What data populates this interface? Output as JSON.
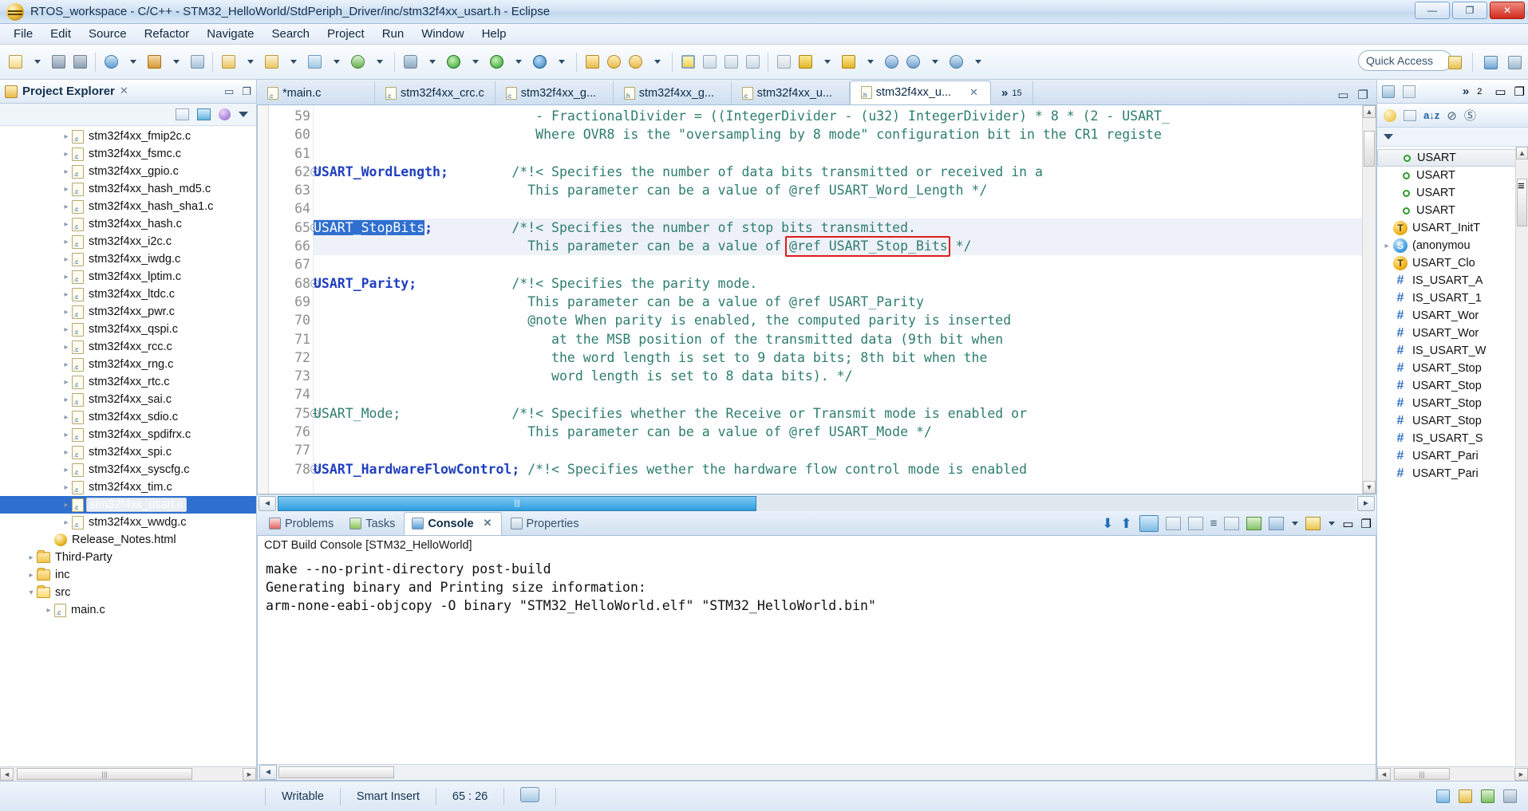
{
  "window": {
    "title": "RTOS_workspace - C/C++ - STM32_HelloWorld/StdPeriph_Driver/inc/stm32f4xx_usart.h - Eclipse",
    "minimize": "—",
    "maximize": "❐",
    "close": "✕"
  },
  "menu": [
    "File",
    "Edit",
    "Source",
    "Refactor",
    "Navigate",
    "Search",
    "Project",
    "Run",
    "Window",
    "Help"
  ],
  "toolbar": {
    "quick_access_placeholder": "Quick Access"
  },
  "project_explorer": {
    "title": "Project Explorer",
    "close_label": "✕",
    "items": [
      {
        "label": "stm32f4xx_fmip2c.c",
        "icon": "c-file-icon",
        "indent": 3,
        "arrow": true
      },
      {
        "label": "stm32f4xx_fsmc.c",
        "icon": "c-file-icon",
        "indent": 3,
        "arrow": true
      },
      {
        "label": "stm32f4xx_gpio.c",
        "icon": "c-file-icon",
        "indent": 3,
        "arrow": true
      },
      {
        "label": "stm32f4xx_hash_md5.c",
        "icon": "c-file-icon",
        "indent": 3,
        "arrow": true
      },
      {
        "label": "stm32f4xx_hash_sha1.c",
        "icon": "c-file-icon",
        "indent": 3,
        "arrow": true
      },
      {
        "label": "stm32f4xx_hash.c",
        "icon": "c-file-icon",
        "indent": 3,
        "arrow": true
      },
      {
        "label": "stm32f4xx_i2c.c",
        "icon": "c-file-icon",
        "indent": 3,
        "arrow": true
      },
      {
        "label": "stm32f4xx_iwdg.c",
        "icon": "c-file-icon",
        "indent": 3,
        "arrow": true
      },
      {
        "label": "stm32f4xx_lptim.c",
        "icon": "c-file-icon",
        "indent": 3,
        "arrow": true
      },
      {
        "label": "stm32f4xx_ltdc.c",
        "icon": "c-file-icon",
        "indent": 3,
        "arrow": true
      },
      {
        "label": "stm32f4xx_pwr.c",
        "icon": "c-file-icon",
        "indent": 3,
        "arrow": true
      },
      {
        "label": "stm32f4xx_qspi.c",
        "icon": "c-file-icon",
        "indent": 3,
        "arrow": true
      },
      {
        "label": "stm32f4xx_rcc.c",
        "icon": "c-file-icon",
        "indent": 3,
        "arrow": true
      },
      {
        "label": "stm32f4xx_rng.c",
        "icon": "c-file-icon",
        "indent": 3,
        "arrow": true
      },
      {
        "label": "stm32f4xx_rtc.c",
        "icon": "c-file-icon",
        "indent": 3,
        "arrow": true
      },
      {
        "label": "stm32f4xx_sai.c",
        "icon": "c-file-icon",
        "indent": 3,
        "arrow": true
      },
      {
        "label": "stm32f4xx_sdio.c",
        "icon": "c-file-icon",
        "indent": 3,
        "arrow": true
      },
      {
        "label": "stm32f4xx_spdifrx.c",
        "icon": "c-file-icon",
        "indent": 3,
        "arrow": true
      },
      {
        "label": "stm32f4xx_spi.c",
        "icon": "c-file-icon",
        "indent": 3,
        "arrow": true
      },
      {
        "label": "stm32f4xx_syscfg.c",
        "icon": "c-file-icon",
        "indent": 3,
        "arrow": true
      },
      {
        "label": "stm32f4xx_tim.c",
        "icon": "c-file-icon",
        "indent": 3,
        "arrow": true
      },
      {
        "label": "stm32f4xx_usart.c",
        "icon": "c-file-icon",
        "indent": 3,
        "arrow": true,
        "selected": true
      },
      {
        "label": "stm32f4xx_wwdg.c",
        "icon": "c-file-icon",
        "indent": 3,
        "arrow": true
      },
      {
        "label": "Release_Notes.html",
        "icon": "html-file-icon",
        "indent": 2,
        "arrow": false
      },
      {
        "label": "Third-Party",
        "icon": "folder-icon",
        "indent": 1,
        "arrow": true
      },
      {
        "label": "inc",
        "icon": "folder-icon",
        "indent": 1,
        "arrow": true
      },
      {
        "label": "src",
        "icon": "folder-open-icon",
        "indent": 1,
        "arrow": true,
        "expanded": true
      },
      {
        "label": "main.c",
        "icon": "c-file-icon",
        "indent": 2,
        "arrow": true
      }
    ]
  },
  "editor": {
    "tabs": [
      {
        "label": "*main.c",
        "type": "c",
        "active": false
      },
      {
        "label": "stm32f4xx_crc.c",
        "type": "c",
        "active": false
      },
      {
        "label": "stm32f4xx_g...",
        "type": "c",
        "active": false
      },
      {
        "label": "stm32f4xx_g...",
        "type": "h",
        "active": false
      },
      {
        "label": "stm32f4xx_u...",
        "type": "c",
        "active": false
      },
      {
        "label": "stm32f4xx_u...",
        "type": "h",
        "active": true
      }
    ],
    "overflow_label": "»",
    "overflow_count": "15",
    "close_label": "✕",
    "lines": [
      {
        "num": "59",
        "fold": false,
        "code": "                            - FractionalDivider = ((IntegerDivider - (u32) IntegerDivider) * 8 * (2 - USART_"
      },
      {
        "num": "60",
        "fold": false,
        "code": "                            Where OVR8 is the \"oversampling by 8 mode\" configuration bit in the CR1 registe"
      },
      {
        "num": "61",
        "fold": false,
        "code": ""
      },
      {
        "num": "62",
        "fold": true,
        "code": "USART_WordLength;        /*!< Specifies the number of data bits transmitted or received in a"
      },
      {
        "num": "63",
        "fold": false,
        "code": "                           This parameter can be a value of @ref USART_Word_Length */"
      },
      {
        "num": "64",
        "fold": false,
        "code": ""
      },
      {
        "num": "65",
        "fold": true,
        "code": "USART_StopBits;          /*!< Specifies the number of stop bits transmitted.",
        "highlight": true,
        "selected_token": "USART_StopBits"
      },
      {
        "num": "66",
        "fold": false,
        "code": "                           This parameter can be a value of @ref USART_Stop_Bits */",
        "highlight": true,
        "boxed_token": "@ref USART_Stop_Bits"
      },
      {
        "num": "67",
        "fold": false,
        "code": ""
      },
      {
        "num": "68",
        "fold": true,
        "code": "USART_Parity;            /*!< Specifies the parity mode."
      },
      {
        "num": "69",
        "fold": false,
        "code": "                           This parameter can be a value of @ref USART_Parity"
      },
      {
        "num": "70",
        "fold": false,
        "code": "                           @note When parity is enabled, the computed parity is inserted"
      },
      {
        "num": "71",
        "fold": false,
        "code": "                              at the MSB position of the transmitted data (9th bit when"
      },
      {
        "num": "72",
        "fold": false,
        "code": "                              the word length is set to 9 data bits; 8th bit when the"
      },
      {
        "num": "73",
        "fold": false,
        "code": "                              word length is set to 8 data bits). */"
      },
      {
        "num": "74",
        "fold": false,
        "code": ""
      },
      {
        "num": "75",
        "fold": true,
        "code": "USART_Mode;              /*!< Specifies whether the Receive or Transmit mode is enabled or"
      },
      {
        "num": "76",
        "fold": false,
        "code": "                           This parameter can be a value of @ref USART_Mode */"
      },
      {
        "num": "77",
        "fold": false,
        "code": ""
      },
      {
        "num": "78",
        "fold": true,
        "code": "USART_HardwareFlowControl; /*!< Specifies wether the hardware flow control mode is enabled"
      }
    ],
    "annotation_color": "#e01b1b"
  },
  "console": {
    "tabs": [
      {
        "label": "Problems",
        "icon": "problems-icon",
        "active": false
      },
      {
        "label": "Tasks",
        "icon": "tasks-icon",
        "active": false
      },
      {
        "label": "Console",
        "icon": "console-icon",
        "active": true
      },
      {
        "label": "Properties",
        "icon": "properties-icon",
        "active": false
      }
    ],
    "close_label": "✕",
    "header": "CDT Build Console [STM32_HelloWorld]",
    "output": [
      "make --no-print-directory post-build",
      "Generating binary and Printing size information:",
      "arm-none-eabi-objcopy -O binary \"STM32_HelloWorld.elf\" \"STM32_HelloWorld.bin\""
    ]
  },
  "outline": {
    "items": [
      {
        "label": "USART",
        "icon": "green-dot-icon",
        "indent": 2,
        "selected": true
      },
      {
        "label": "USART",
        "icon": "green-dot-icon",
        "indent": 2
      },
      {
        "label": "USART",
        "icon": "green-dot-icon",
        "indent": 2
      },
      {
        "label": "USART",
        "icon": "green-dot-icon",
        "indent": 2
      },
      {
        "label": "USART_InitT",
        "icon": "typedef-icon",
        "indent": 1
      },
      {
        "label": "(anonymou",
        "icon": "struct-icon",
        "indent": 1,
        "arrow": true
      },
      {
        "label": "USART_Clo",
        "icon": "typedef-icon",
        "indent": 1
      },
      {
        "label": "IS_USART_A",
        "icon": "define-icon",
        "indent": 1
      },
      {
        "label": "IS_USART_1",
        "icon": "define-icon",
        "indent": 1
      },
      {
        "label": "USART_Wor",
        "icon": "define-icon",
        "indent": 1
      },
      {
        "label": "USART_Wor",
        "icon": "define-icon",
        "indent": 1
      },
      {
        "label": "IS_USART_W",
        "icon": "define-icon",
        "indent": 1
      },
      {
        "label": "USART_Stop",
        "icon": "define-icon",
        "indent": 1
      },
      {
        "label": "USART_Stop",
        "icon": "define-icon",
        "indent": 1
      },
      {
        "label": "USART_Stop",
        "icon": "define-icon",
        "indent": 1
      },
      {
        "label": "USART_Stop",
        "icon": "define-icon",
        "indent": 1
      },
      {
        "label": "IS_USART_S",
        "icon": "define-icon",
        "indent": 1
      },
      {
        "label": "USART_Pari",
        "icon": "define-icon",
        "indent": 1
      },
      {
        "label": "USART_Pari",
        "icon": "define-icon",
        "indent": 1
      }
    ]
  },
  "statusbar": {
    "writable": "Writable",
    "insert_mode": "Smart Insert",
    "position": "65 : 26"
  }
}
